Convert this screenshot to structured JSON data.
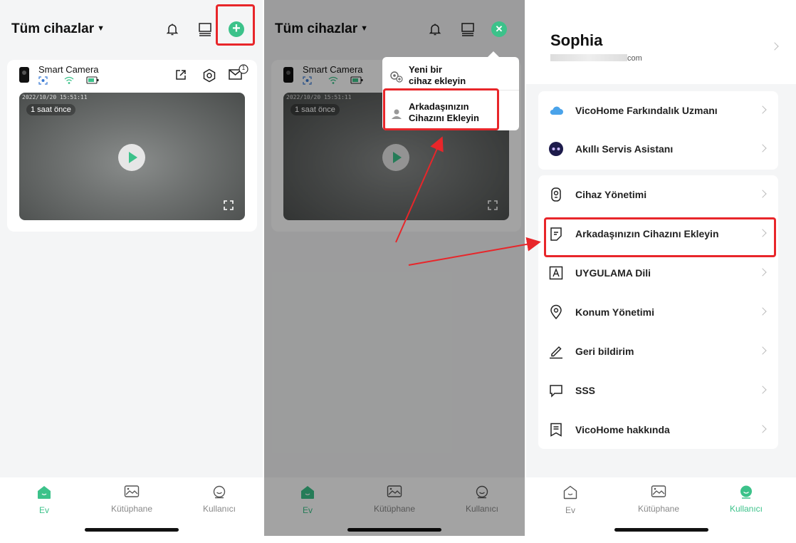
{
  "colors": {
    "accent": "#3cc28a",
    "highlight": "#e8262a"
  },
  "home": {
    "title": "Tüm cihazlar",
    "device": {
      "name": "Smart Camera",
      "timestamp": "2022/10/20 15:51:11",
      "last_seen": "1 saat önce",
      "message_count": "1"
    }
  },
  "popup": {
    "add_new_line1": "Yeni bir",
    "add_new_line2": "cihaz ekleyin",
    "add_friend_line1": "Arkadaşınızın",
    "add_friend_line2": "Cihazını Ekleyin"
  },
  "tabs": [
    {
      "label": "Ev",
      "icon": "home-icon"
    },
    {
      "label": "Kütüphane",
      "icon": "library-icon"
    },
    {
      "label": "Kullanıcı",
      "icon": "user-icon"
    }
  ],
  "profile": {
    "name": "Sophia",
    "email_suffix": "com"
  },
  "menu_group1": [
    {
      "label": "VicoHome Farkındalık Uzmanı",
      "icon": "cloud-icon"
    },
    {
      "label": "Akıllı Servis Asistanı",
      "icon": "assistant-icon"
    }
  ],
  "menu_group2": [
    {
      "label": "Cihaz Yönetimi",
      "icon": "device-icon"
    },
    {
      "label": "Arkadaşınızın Cihazını Ekleyin",
      "icon": "share-device-icon"
    },
    {
      "label": "UYGULAMA Dili",
      "icon": "language-icon"
    },
    {
      "label": "Konum Yönetimi",
      "icon": "location-icon"
    },
    {
      "label": "Geri bildirim",
      "icon": "feedback-icon"
    },
    {
      "label": "SSS",
      "icon": "faq-icon"
    },
    {
      "label": "VicoHome hakkında",
      "icon": "about-icon"
    }
  ]
}
